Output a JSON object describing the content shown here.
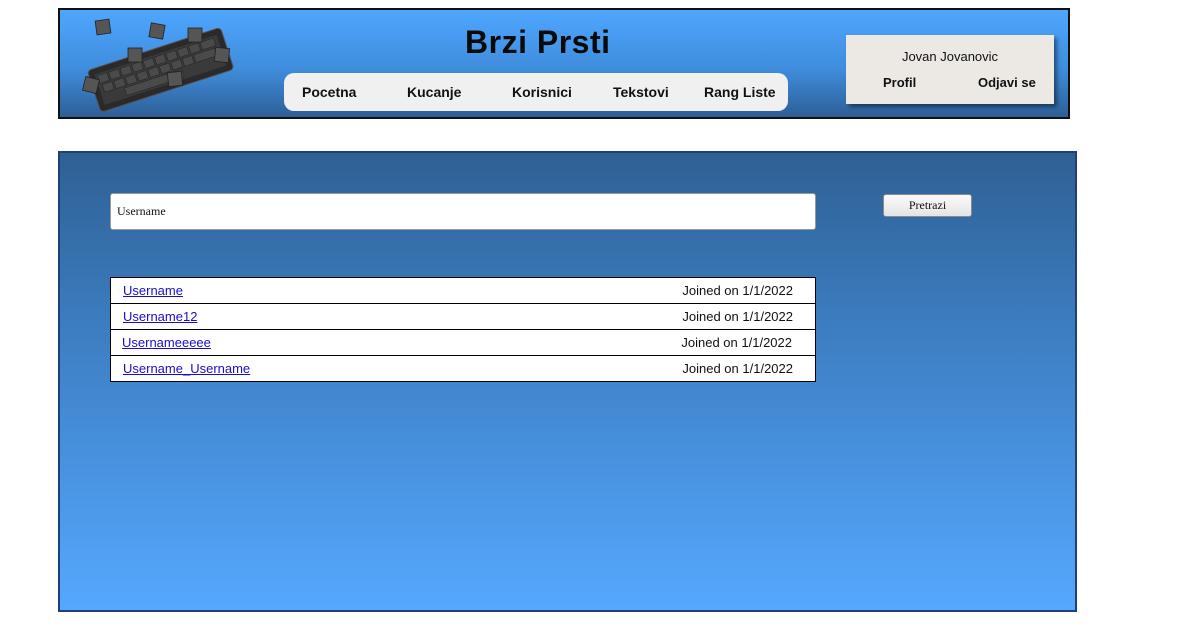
{
  "header": {
    "title": "Brzi Prsti",
    "nav": [
      "Pocetna",
      "Kucanje",
      "Korisnici",
      "Tekstovi",
      "Rang Liste"
    ],
    "user": {
      "name": "Jovan Jovanovic",
      "profile_label": "Profil",
      "logout_label": "Odjavi se"
    }
  },
  "search": {
    "value": "Username",
    "button_label": "Pretrazi"
  },
  "results": [
    {
      "username": "Username",
      "joined": "Joined on 1/1/2022"
    },
    {
      "username": "Username12",
      "joined": "Joined on 1/1/2022"
    },
    {
      "username": "Usernameeeee",
      "joined": "Joined on 1/1/2022"
    },
    {
      "username": "Username_Username",
      "joined": "Joined on 1/1/2022"
    }
  ]
}
